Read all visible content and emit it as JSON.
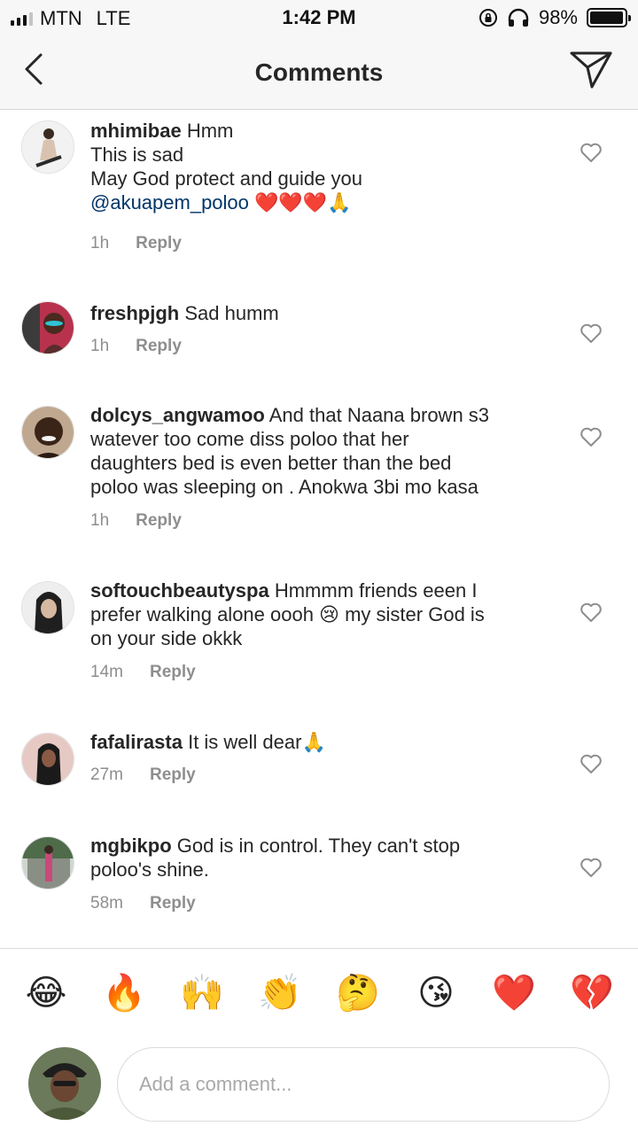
{
  "status_bar": {
    "carrier": "MTN",
    "network": "LTE",
    "time": "1:42 PM",
    "battery_text": "98%",
    "battery_level": 0.98,
    "icons": [
      "signal-icon",
      "rotation-lock-icon",
      "headphones-icon",
      "battery-icon"
    ]
  },
  "header": {
    "title": "Comments",
    "back_icon": "chevron-left-icon",
    "share_icon": "send-icon"
  },
  "comments": [
    {
      "username": "mhimibae",
      "lines": [
        "Hmm",
        "This is sad",
        "May God protect and guide you"
      ],
      "mention": "@akuapem_poloo",
      "emoji_suffix": "❤️❤️❤️🙏",
      "time": "1h",
      "reply_label": "Reply",
      "liked": false
    },
    {
      "username": "freshpjgh",
      "text": "Sad humm",
      "time": "1h",
      "reply_label": "Reply",
      "liked": false
    },
    {
      "username": "dolcys_angwamoo",
      "line1": "And that Naana brown s3",
      "line2": "watever too come diss poloo that her",
      "line3": "daughters bed is even better than the bed",
      "line4": "poloo was sleeping on . Anokwa 3bi mo kasa",
      "time": "1h",
      "reply_label": "Reply",
      "liked": false
    },
    {
      "username": "softouchbeautyspa",
      "line1": "Hmmmm friends eeen I",
      "line2": "prefer walking alone oooh 😢 my sister God is",
      "line3": "on your side okkk",
      "time": "14m",
      "reply_label": "Reply",
      "liked": false
    },
    {
      "username": "fafalirasta",
      "text": "It is well dear🙏",
      "time": "27m",
      "reply_label": "Reply",
      "liked": false
    },
    {
      "username": "mgbikpo",
      "line1": "God is in control. They can't stop",
      "line2": "poloo's shine.",
      "time": "58m",
      "reply_label": "Reply",
      "liked": false
    }
  ],
  "emoji_bar": [
    "😂",
    "🔥",
    "🙌",
    "👏",
    "🤔",
    "😘",
    "❤️",
    "💔"
  ],
  "composer": {
    "placeholder": "Add a comment..."
  }
}
